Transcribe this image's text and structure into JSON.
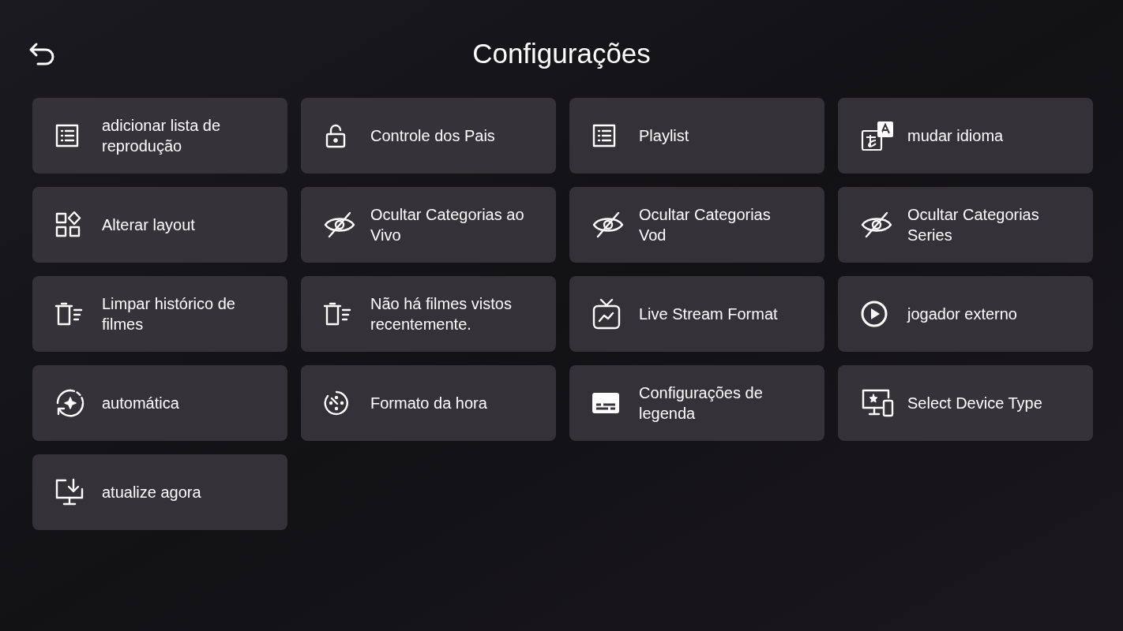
{
  "header": {
    "title": "Configurações"
  },
  "items": [
    {
      "label": "adicionar lista de reprodução",
      "kind": "list"
    },
    {
      "label": "Controle dos Pais",
      "kind": "lock"
    },
    {
      "label": "Playlist",
      "kind": "list"
    },
    {
      "label": "mudar idioma",
      "kind": "translate"
    },
    {
      "label": "Alterar layout",
      "kind": "layout"
    },
    {
      "label": "Ocultar Categorias ao Vivo",
      "kind": "hide"
    },
    {
      "label": "Ocultar Categorias Vod",
      "kind": "hide"
    },
    {
      "label": "Ocultar Categorias Series",
      "kind": "hide"
    },
    {
      "label": "Limpar histórico de filmes",
      "kind": "clear"
    },
    {
      "label": "Não há filmes vistos recentemente.",
      "kind": "clear"
    },
    {
      "label": "Live Stream Format",
      "kind": "tv"
    },
    {
      "label": "jogador externo",
      "kind": "play"
    },
    {
      "label": "automática",
      "kind": "auto"
    },
    {
      "label": "Formato da hora",
      "kind": "timer"
    },
    {
      "label": "Configurações de legenda",
      "kind": "subtitles"
    },
    {
      "label": "Select Device Type",
      "kind": "device"
    },
    {
      "label": "atualize agora",
      "kind": "download"
    }
  ]
}
